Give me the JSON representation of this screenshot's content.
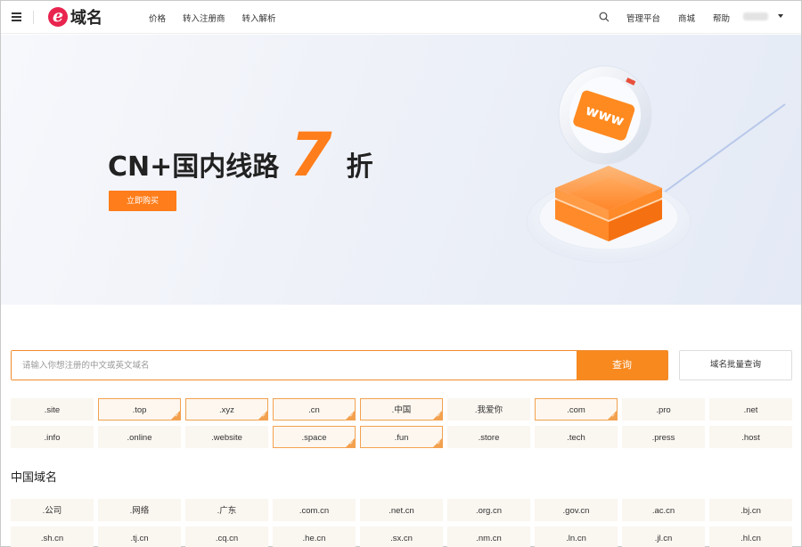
{
  "header": {
    "logo_text": "域名",
    "nav_left": [
      "价格",
      "转入注册商",
      "转入解析"
    ],
    "nav_right": [
      "管理平台",
      "商城",
      "帮助"
    ]
  },
  "banner": {
    "headline_text": "CN+国内线路",
    "discount_number": "7",
    "discount_suffix": "折",
    "buy_label": "立即购买",
    "art_label": "www"
  },
  "search": {
    "placeholder": "请输入你想注册的中文或英文域名",
    "button_label": "查询",
    "bulk_label": "域名批量查询"
  },
  "tlds": [
    {
      "name": ".site",
      "hot": false
    },
    {
      "name": ".top",
      "hot": true
    },
    {
      "name": ".xyz",
      "hot": true
    },
    {
      "name": ".cn",
      "hot": true
    },
    {
      "name": ".中国",
      "hot": true
    },
    {
      "name": ".我爱你",
      "hot": false
    },
    {
      "name": ".com",
      "hot": true
    },
    {
      "name": ".pro",
      "hot": false
    },
    {
      "name": ".net",
      "hot": false
    },
    {
      "name": ".info",
      "hot": false
    },
    {
      "name": ".online",
      "hot": false
    },
    {
      "name": ".website",
      "hot": false
    },
    {
      "name": ".space",
      "hot": true
    },
    {
      "name": ".fun",
      "hot": true
    },
    {
      "name": ".store",
      "hot": false
    },
    {
      "name": ".tech",
      "hot": false
    },
    {
      "name": ".press",
      "hot": false
    },
    {
      "name": ".host",
      "hot": false
    }
  ],
  "china_section": {
    "title": "中国域名",
    "tlds": [
      ".公司",
      ".网络",
      ".广东",
      ".com.cn",
      ".net.cn",
      ".org.cn",
      ".gov.cn",
      ".ac.cn",
      ".bj.cn",
      ".sh.cn",
      ".tj.cn",
      ".cq.cn",
      ".he.cn",
      ".sx.cn",
      ".nm.cn",
      ".ln.cn",
      ".jl.cn",
      ".hl.cn"
    ]
  },
  "colors": {
    "accent": "#f7891f",
    "logo": "#e8244f"
  }
}
